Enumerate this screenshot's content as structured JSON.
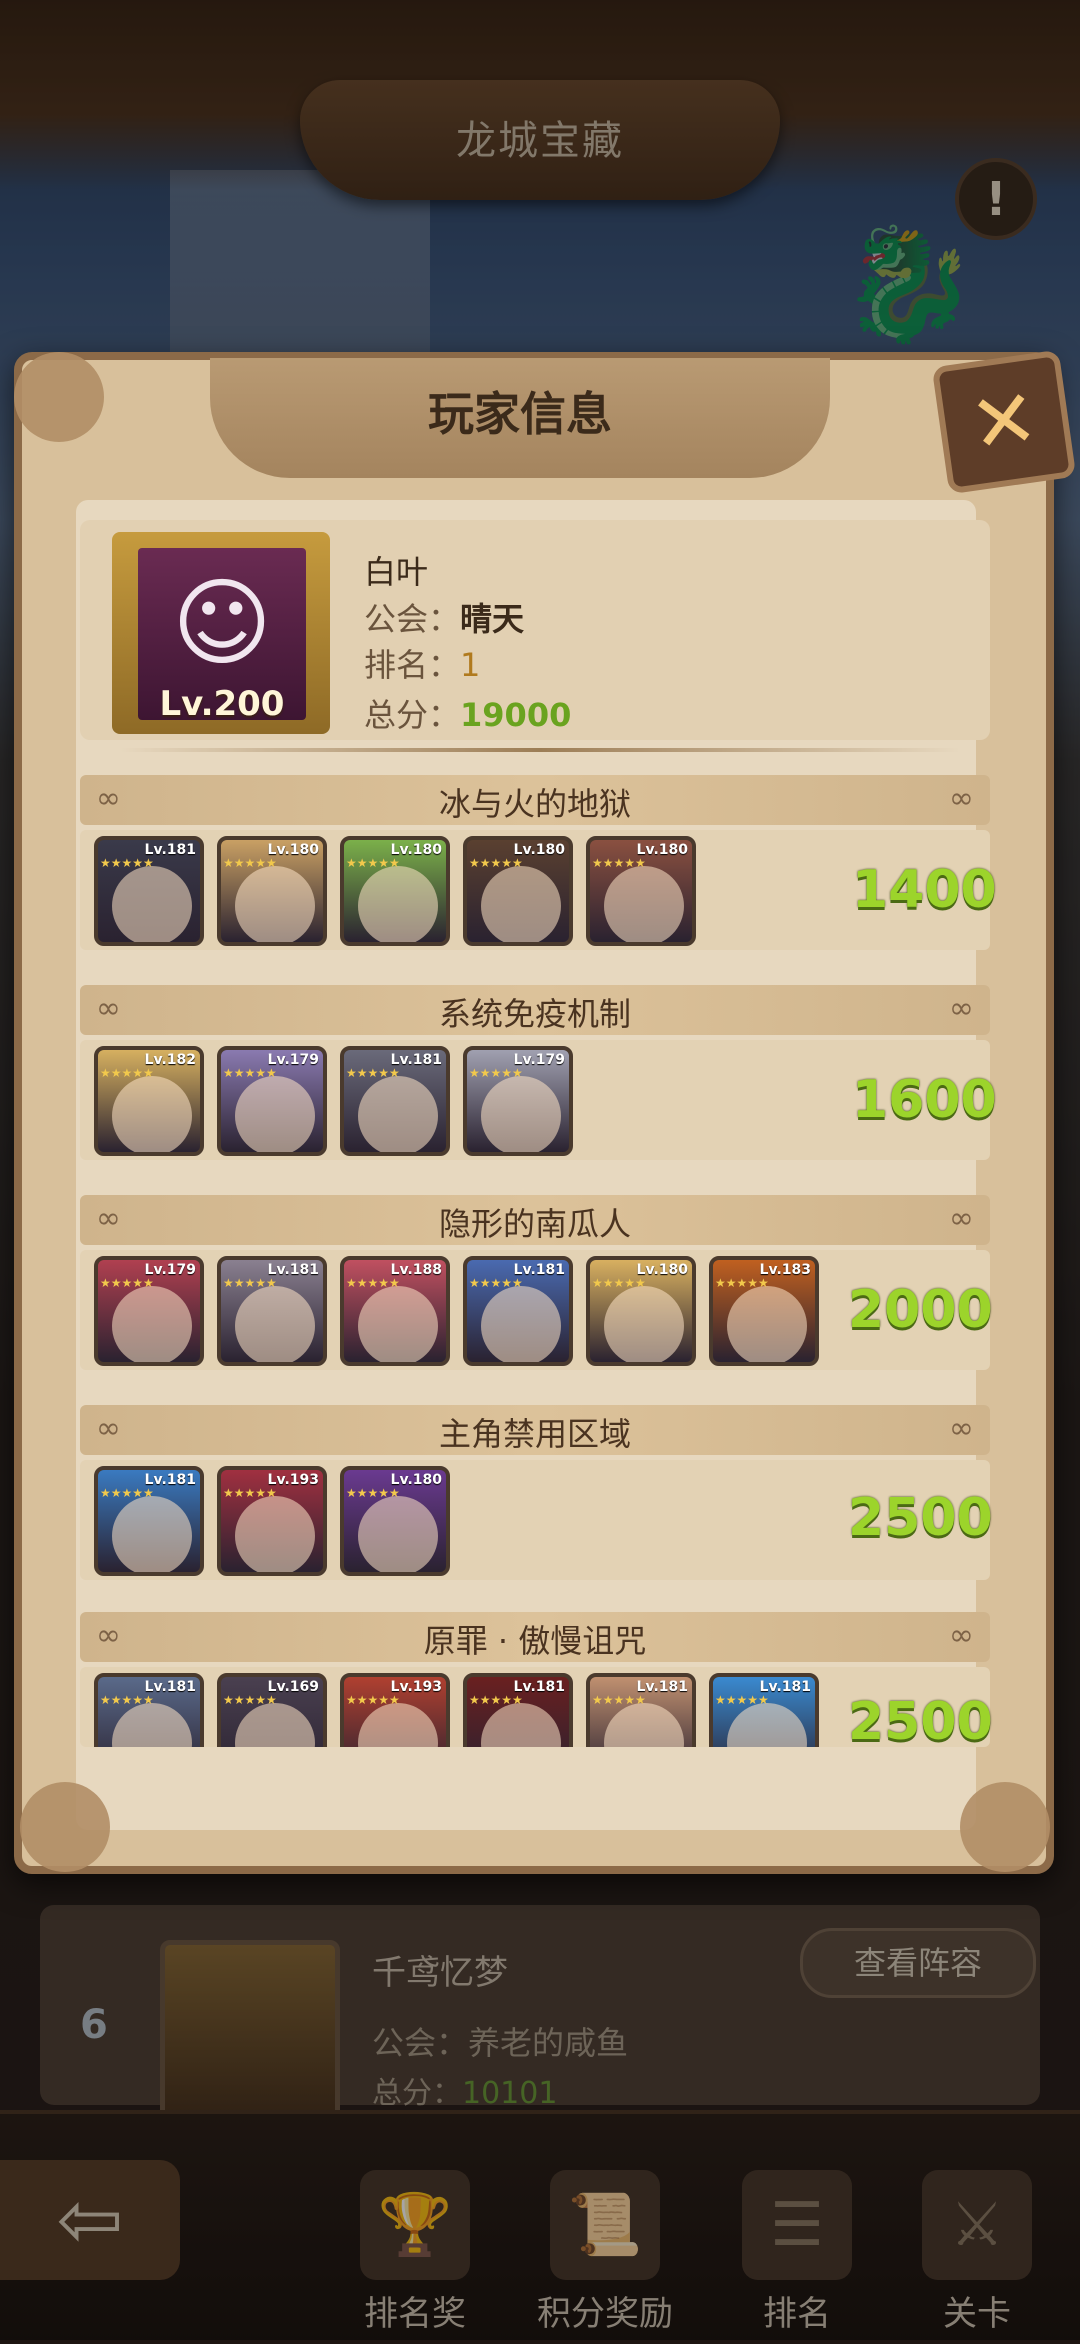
{
  "page": {
    "title": "龙城宝藏",
    "info_icon": "!"
  },
  "background_row": {
    "rank": "6",
    "name": "千鸢忆梦",
    "guild_label": "公会：",
    "guild": "养老的咸鱼",
    "score_label": "总分：",
    "score": "10101",
    "view_button": "查看阵容"
  },
  "nav": {
    "back_icon": "⇦",
    "items": [
      {
        "label": "排名奖",
        "icon": "trophy-icon"
      },
      {
        "label": "积分奖励",
        "icon": "scroll-icon"
      },
      {
        "label": "排名",
        "icon": "ranking-icon"
      },
      {
        "label": "关卡",
        "icon": "stage-icon"
      }
    ]
  },
  "dialog": {
    "title": "玩家信息",
    "close_icon": "✕",
    "player": {
      "name": "白叶",
      "guild_label": "公会：",
      "guild": "晴天",
      "rank_label": "排名：",
      "rank": "1",
      "score_label": "总分：",
      "score": "19000",
      "level": "Lv.200"
    },
    "sections": [
      {
        "title": "冰与火的地狱",
        "score": "1400",
        "heroes": [
          {
            "level": "Lv.181",
            "color": "#3a3a4a"
          },
          {
            "level": "Lv.180",
            "color": "#c9a064"
          },
          {
            "level": "Lv.180",
            "color": "#7bb04a"
          },
          {
            "level": "Lv.180",
            "color": "#5a4030"
          },
          {
            "level": "Lv.180",
            "color": "#8a5040"
          }
        ]
      },
      {
        "title": "系统免疫机制",
        "score": "1600",
        "heroes": [
          {
            "level": "Lv.182",
            "color": "#d6b060"
          },
          {
            "level": "Lv.179",
            "color": "#8a7ab0"
          },
          {
            "level": "Lv.181",
            "color": "#6a6a7a"
          },
          {
            "level": "Lv.179",
            "color": "#a0a0b0"
          }
        ]
      },
      {
        "title": "隐形的南瓜人",
        "score": "2000",
        "heroes": [
          {
            "level": "Lv.179",
            "color": "#b04050"
          },
          {
            "level": "Lv.181",
            "color": "#8a8090"
          },
          {
            "level": "Lv.188",
            "color": "#c05060"
          },
          {
            "level": "Lv.181",
            "color": "#4a6ab0"
          },
          {
            "level": "Lv.180",
            "color": "#d8b060"
          },
          {
            "level": "Lv.183",
            "color": "#c06020"
          }
        ]
      },
      {
        "title": "主角禁用区域",
        "score": "2500",
        "heroes": [
          {
            "level": "Lv.181",
            "color": "#3a7ac0"
          },
          {
            "level": "Lv.193",
            "color": "#a03040"
          },
          {
            "level": "Lv.180",
            "color": "#6a3a90"
          }
        ]
      },
      {
        "title": "原罪 · 傲慢诅咒",
        "score": "2500",
        "heroes": [
          {
            "level": "Lv.181",
            "color": "#5a6a8a"
          },
          {
            "level": "Lv.169",
            "color": "#4a4050"
          },
          {
            "level": "Lv.193",
            "color": "#b04030"
          },
          {
            "level": "Lv.181",
            "color": "#6a2020"
          },
          {
            "level": "Lv.181",
            "color": "#c09070"
          },
          {
            "level": "Lv.181",
            "color": "#3a8ad0"
          }
        ]
      }
    ]
  }
}
